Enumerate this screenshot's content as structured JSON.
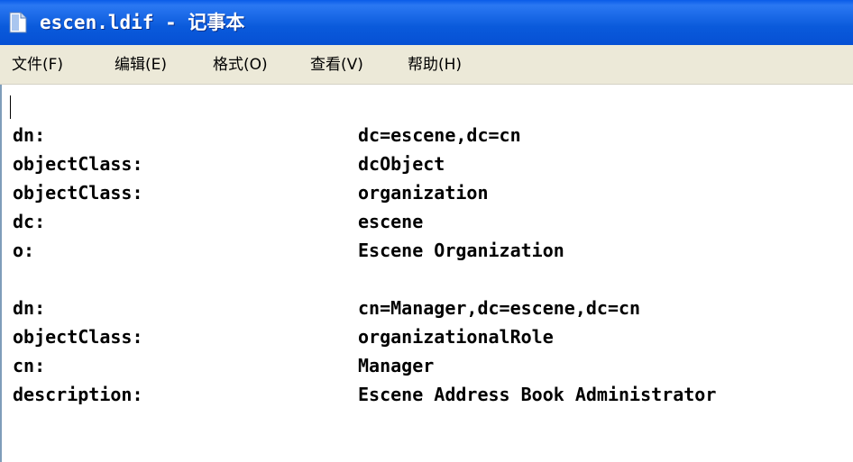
{
  "window": {
    "title": "escen.ldif - 记事本"
  },
  "menu": [
    {
      "label": "文件(F)"
    },
    {
      "label": "编辑(E)"
    },
    {
      "label": "格式(O)"
    },
    {
      "label": "查看(V)"
    },
    {
      "label": "帮助(H)"
    }
  ],
  "document": {
    "lines": [
      {
        "key": "",
        "value": ""
      },
      {
        "key": "dn:",
        "value": "dc=escene,dc=cn"
      },
      {
        "key": "objectClass:",
        "value": "dcObject"
      },
      {
        "key": "objectClass:",
        "value": "organization"
      },
      {
        "key": "dc:",
        "value": "escene"
      },
      {
        "key": "o:",
        "value": "Escene Organization"
      },
      {
        "key": "",
        "value": ""
      },
      {
        "key": "dn:",
        "value": "cn=Manager,dc=escene,dc=cn"
      },
      {
        "key": "objectClass:",
        "value": "organizationalRole"
      },
      {
        "key": "cn:",
        "value": "Manager"
      },
      {
        "key": "description:",
        "value": "Escene Address Book Administrator"
      }
    ]
  },
  "icons": {
    "app": "notepad-icon"
  }
}
